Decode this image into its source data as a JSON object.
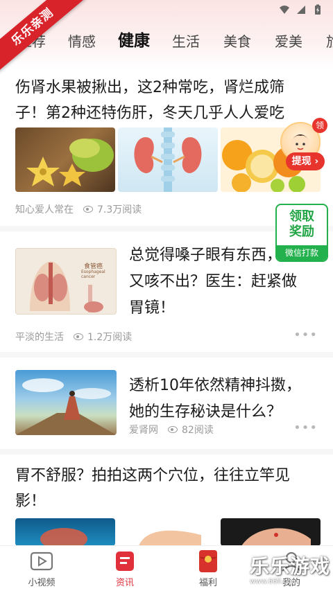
{
  "ribbon": {
    "label": "乐乐亲测"
  },
  "tabs": [
    {
      "label": "推荐",
      "active": false
    },
    {
      "label": "情感",
      "active": false
    },
    {
      "label": "健康",
      "active": true
    },
    {
      "label": "生活",
      "active": false
    },
    {
      "label": "美食",
      "active": false
    },
    {
      "label": "爱美",
      "active": false
    },
    {
      "label": "旅",
      "active": false
    }
  ],
  "articles": [
    {
      "title_line1": "伤肾水果被揪出，这2种常吃，肾烂成筛",
      "title_line2": "子！第2种还特伤肝，冬天几乎人人爱吃",
      "source": "知心爱人常在",
      "reads": "7.3万阅读"
    },
    {
      "title_line1": "总觉得嗓子眼有东西，吐",
      "title_line2": "又咳不出？医生：赶紧做",
      "title_line3": "胃镜！",
      "source": "平淡的生活",
      "reads": "1.2万阅读",
      "thumb_label": "食管癌",
      "thumb_sub": "Esophageal cancer"
    },
    {
      "title_line1": "透析10年依然精神抖擞，",
      "title_line2": "她的生存秘诀是什么？",
      "source": "爱肾网",
      "reads": "82阅读"
    },
    {
      "title_line1": "胃不舒服？拍拍这两个穴位，往往立竿见",
      "title_line2": "影！"
    }
  ],
  "widgets": {
    "redpacket_button": "提现",
    "redpacket_badge": "领",
    "reward_title1": "领取",
    "reward_title2": "奖励",
    "reward_sub": "微信打款"
  },
  "nav": [
    {
      "label": "小视频",
      "icon": "video-icon"
    },
    {
      "label": "资讯",
      "icon": "news-icon",
      "active": true
    },
    {
      "label": "福利",
      "icon": "gift-icon"
    },
    {
      "label": "我的",
      "icon": "profile-icon"
    }
  ],
  "watermark": {
    "big": "乐乐游戏",
    "small": "www.66ll.com"
  },
  "colors": {
    "accent": "#e0313a",
    "green": "#22b14c"
  }
}
